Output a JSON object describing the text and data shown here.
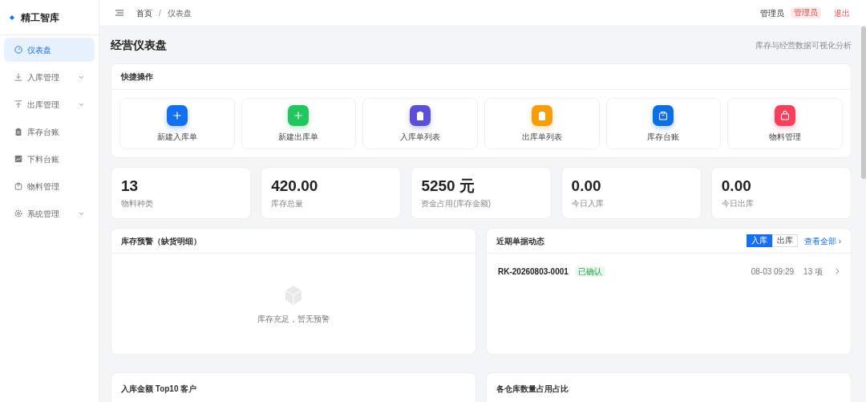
{
  "brand": {
    "name": "精工智库"
  },
  "sidebar": {
    "items": [
      {
        "label": "仪表盘",
        "kind": "dashboard",
        "selected": true,
        "expandable": false
      },
      {
        "label": "入库管理",
        "kind": "download",
        "selected": false,
        "expandable": true
      },
      {
        "label": "出库管理",
        "kind": "upload",
        "selected": false,
        "expandable": true
      },
      {
        "label": "库存台账",
        "kind": "clipboard",
        "selected": false,
        "expandable": false
      },
      {
        "label": "下料台账",
        "kind": "chart",
        "selected": false,
        "expandable": false
      },
      {
        "label": "物料管理",
        "kind": "box",
        "selected": false,
        "expandable": false
      },
      {
        "label": "系统管理",
        "kind": "gear",
        "selected": false,
        "expandable": true
      }
    ]
  },
  "header": {
    "breadcrumb": [
      "首页",
      "仪表盘"
    ],
    "breadcrumb_separator": "/",
    "user": "管理员",
    "role_tag": "管理员",
    "logout": "退出"
  },
  "page": {
    "title": "经营仪表盘",
    "subtitle": "库存与经营数据可视化分析"
  },
  "quick_actions": {
    "title": "快捷操作",
    "items": [
      {
        "label": "新建入库单",
        "kind": "plus",
        "color": "#1570ef"
      },
      {
        "label": "新建出库单",
        "kind": "plus",
        "color": "#22c55e"
      },
      {
        "label": "入库单列表",
        "kind": "clipboard",
        "color": "#5b4fd6"
      },
      {
        "label": "出库单列表",
        "kind": "clipboard",
        "color": "#f59e0b"
      },
      {
        "label": "库存台账",
        "kind": "box",
        "color": "#0f6fe0"
      },
      {
        "label": "物料管理",
        "kind": "bag",
        "color": "#f43f5e"
      }
    ]
  },
  "stats": [
    {
      "value": "13",
      "label": "物料种类"
    },
    {
      "value": "420.00",
      "label": "库存总量"
    },
    {
      "value": "5250 元",
      "label": "资金占用(库存金额)"
    },
    {
      "value": "0.00",
      "label": "今日入库"
    },
    {
      "value": "0.00",
      "label": "今日出库"
    }
  ],
  "stock_alert": {
    "title": "库存预警（缺货明细）",
    "empty_text": "库存充足，暂无预警"
  },
  "recent_docs": {
    "title": "近期单据动态",
    "tabs": [
      {
        "label": "入库",
        "selected": true
      },
      {
        "label": "出库",
        "selected": false
      }
    ],
    "view_all": "查看全部 ›",
    "rows": [
      {
        "code": "RK-20260803-0001",
        "status": "已确认",
        "time": "08-03 09:29",
        "count": "13 项"
      }
    ]
  },
  "bottom_panels": [
    {
      "title": "入库金额 Top10 客户"
    },
    {
      "title": "各仓库数量占用占比"
    }
  ]
}
